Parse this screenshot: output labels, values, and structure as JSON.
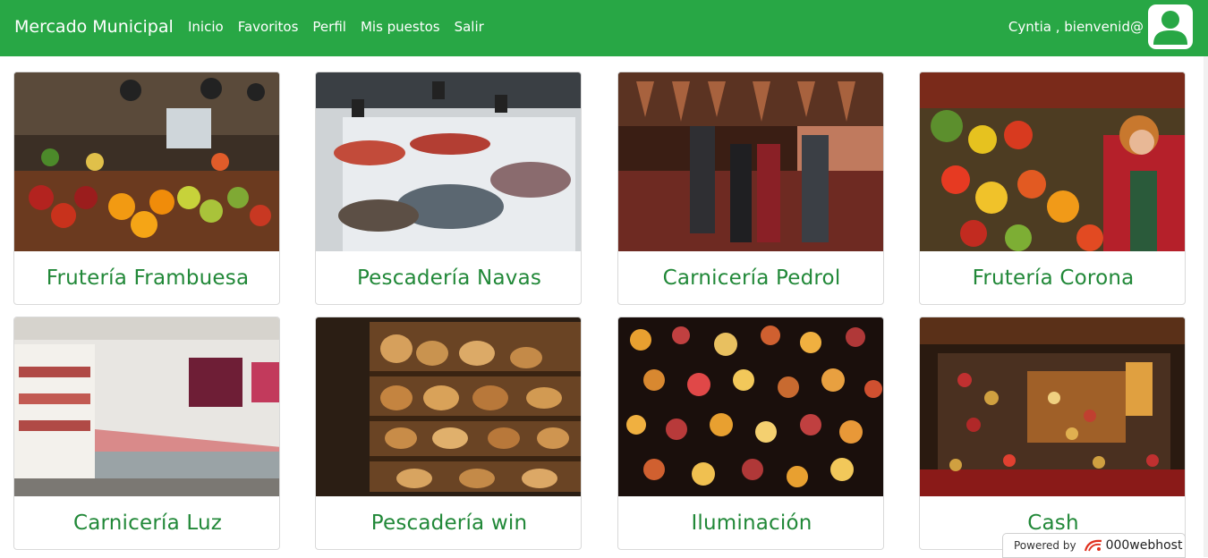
{
  "navbar": {
    "brand": "Mercado Municipal",
    "links": [
      "Inicio",
      "Favoritos",
      "Perfil",
      "Mis puestos",
      "Salir"
    ],
    "welcome": "Cyntia , bienvenid@",
    "avatar_icon": "user-icon"
  },
  "cards": [
    {
      "title": "Frutería Frambuesa",
      "photo": "fruit-stall-photo"
    },
    {
      "title": "Pescadería Navas",
      "photo": "fish-counter-photo"
    },
    {
      "title": "Carnicería Pedrol",
      "photo": "butcher-shop-photo"
    },
    {
      "title": "Frutería Corona",
      "photo": "vegetable-stall-photo"
    },
    {
      "title": "Carnicería Luz",
      "photo": "meat-display-photo"
    },
    {
      "title": "Pescadería win",
      "photo": "bakery-shelves-photo"
    },
    {
      "title": "Iluminación",
      "photo": "lamps-shop-photo"
    },
    {
      "title": "Cash",
      "photo": "souvenir-stall-photo"
    }
  ],
  "footer_badge": {
    "powered_by": "Powered by",
    "host": "000webhost"
  },
  "colors": {
    "navbar": "#28a745",
    "card_title": "#218838"
  }
}
